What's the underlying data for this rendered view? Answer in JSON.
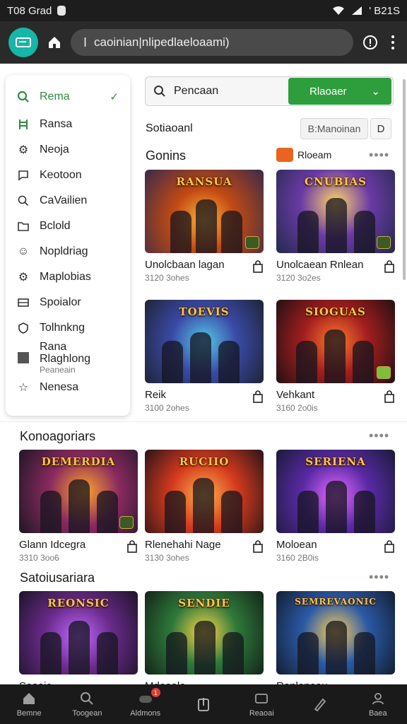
{
  "status_bar": {
    "left_text": "T08 Grad",
    "right_text": "' B21S"
  },
  "browser": {
    "url": "caoinian|nlipedlaeloaami)"
  },
  "sidebar": {
    "items": [
      {
        "label": "Rema",
        "icon": "search-icon",
        "active": true
      },
      {
        "label": "Ransa",
        "icon": "ladder-icon"
      },
      {
        "label": "Neoja",
        "icon": "gear-icon"
      },
      {
        "label": "Keotoon",
        "icon": "chat-icon"
      },
      {
        "label": "CaVailien",
        "icon": "search-icon"
      },
      {
        "label": "Bclold",
        "icon": "folder-icon"
      },
      {
        "label": "Nopldriag",
        "icon": "smile-icon"
      },
      {
        "label": "Maplobias",
        "icon": "settings-icon"
      },
      {
        "label": "Spoialor",
        "icon": "card-icon"
      },
      {
        "label": "Tolhnkng",
        "icon": "shield-icon"
      },
      {
        "label": "Rana Rlaghlong",
        "sub": "Peaneain",
        "icon": "square-icon"
      },
      {
        "label": "Nenesa",
        "icon": "star-icon"
      }
    ]
  },
  "search": {
    "placeholder": "Pencaan",
    "button_label": "Rlaoaer"
  },
  "sort": {
    "label": "Sotiaoanl",
    "filter_label": "B:Manoinan",
    "filter_icon_label": "D"
  },
  "sections": {
    "games": {
      "title": "Gonins",
      "tag_label": "Rloeam"
    },
    "categories": {
      "title": "Konoagoriars"
    },
    "subscriptions": {
      "title": "Satoiusariara"
    }
  },
  "games": [
    {
      "art_title": "RANSUA",
      "name": "Unolcbaan lagan",
      "sub": "3120 3ohes"
    },
    {
      "art_title": "CNUBIAS",
      "name": "Unolcaean Rnlean",
      "sub": "3120 3o2es"
    },
    {
      "art_title": "TOEVIS",
      "name": "Reik",
      "sub": "3100 2ohes"
    },
    {
      "art_title": "SIOGUAS",
      "name": "Vehkant",
      "sub": "3160 2o0is"
    }
  ],
  "categories": [
    {
      "art_title": "DEMERDIA",
      "name": "Glann Idcegra",
      "sub": "3310 3oo6"
    },
    {
      "art_title": "RUCIIO",
      "name": "Rlenehahi Nage",
      "sub": "3130 3ohes"
    },
    {
      "art_title": "SERIENA",
      "name": "Moloean",
      "sub": "3160 2B0is"
    }
  ],
  "subscriptions": [
    {
      "art_title": "REONSIC",
      "name": "Seaaic"
    },
    {
      "art_title": "SENDIE",
      "name": "Mdeaale"
    },
    {
      "art_title": "SEMREVAONIC",
      "name": "Ranlenoau"
    }
  ],
  "bottom_nav": [
    {
      "label": "Bemne",
      "icon": "home-icon"
    },
    {
      "label": "Toogean",
      "icon": "search-icon"
    },
    {
      "label": "Aldmons",
      "icon": "gamepad-icon",
      "badge": "1"
    },
    {
      "label": "",
      "icon": "share-icon"
    },
    {
      "label": "Reaoai",
      "icon": "controller-icon"
    },
    {
      "label": "",
      "icon": "pen-icon"
    },
    {
      "label": "Baea",
      "icon": "profile-icon"
    }
  ],
  "colors": {
    "accent": "#2e9e3c",
    "status_bar": "#1d1d1d",
    "browser_bar": "#2a2a2a",
    "app_badge": "#16b6a8",
    "tag": "#e86420"
  }
}
